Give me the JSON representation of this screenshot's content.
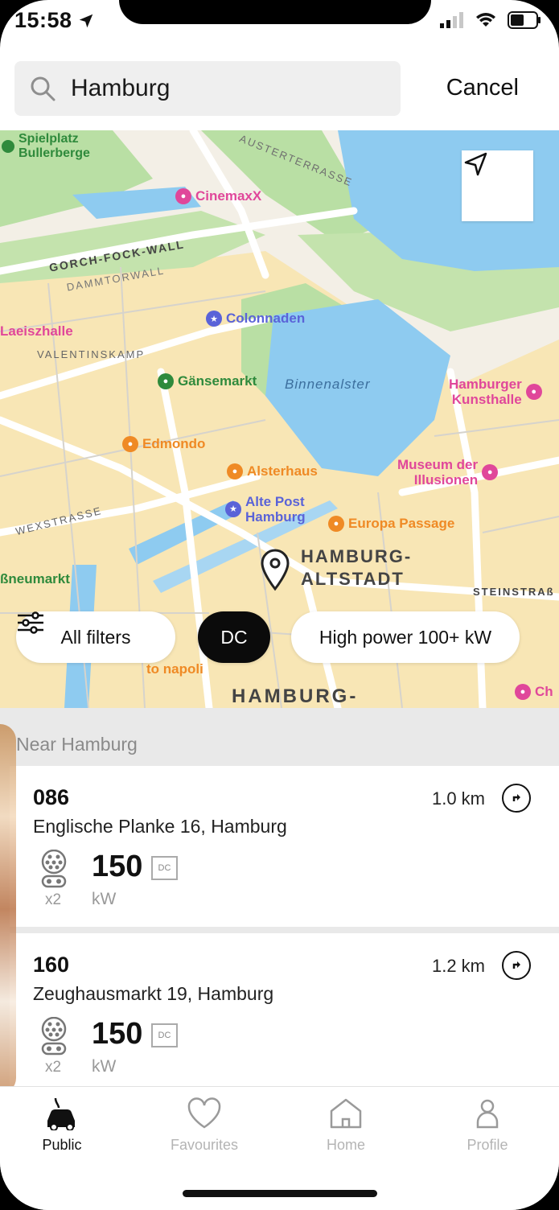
{
  "status": {
    "time": "15:58"
  },
  "search": {
    "query": "Hamburg",
    "cancel_label": "Cancel"
  },
  "map": {
    "labels": {
      "spielplatz": "Spielplatz\nBullerberge",
      "austerterrasse": "AUSTERTERRASSE",
      "cinemaxx": "CinemaxX",
      "gorch": "GORCH-FOCK-WALL",
      "dammtorwall": "DAMMTORWALL",
      "colonnaden": "Colonnaden",
      "laeiszhalle": "Laeiszhalle",
      "valentinskamp": "VALENTINSKAMP",
      "gaensemarkt": "Gänsemarkt",
      "binnenalster": "Binnenalster",
      "kunsthalle": "Hamburger\nKunsthalle",
      "edmondo": "Edmondo",
      "alsterhaus": "Alsterhaus",
      "museum": "Museum der\nIllusionen",
      "altepost": "Alte Post\nHamburg",
      "europa": "Europa Passage",
      "wexstrasse": "WEXSTRASSE",
      "altstadt": "HAMBURG-\nALTSTADT",
      "neumarkt": "ßneumarkt",
      "steinstrasse": "STEINSTRAß",
      "napoli": "to napoli",
      "hamburg_bottom": "HAMBURG-",
      "ch": "Ch"
    }
  },
  "filters": {
    "all_filters": "All filters",
    "dc": "DC",
    "high_power": "High power 100+ kW"
  },
  "list": {
    "section_title": "Near Hamburg",
    "stations": [
      {
        "id": "086",
        "address": "Englische Planke 16, Hamburg",
        "distance": "1.0 km",
        "count": "x2",
        "power": "150",
        "unit": "kW",
        "type": "DC"
      },
      {
        "id": "160",
        "address": "Zeughausmarkt 19, Hamburg",
        "distance": "1.2 km",
        "count": "x2",
        "power": "150",
        "unit": "kW",
        "type": "DC"
      }
    ]
  },
  "tabs": [
    {
      "label": "Public",
      "icon": "car-plug-icon",
      "active": true
    },
    {
      "label": "Favourites",
      "icon": "heart-icon",
      "active": false
    },
    {
      "label": "Home",
      "icon": "home-icon",
      "active": false
    },
    {
      "label": "Profile",
      "icon": "person-icon",
      "active": false
    }
  ],
  "colors": {
    "water": "#8ecbf0",
    "park": "#b9dfa4",
    "urban": "#f8e6b5",
    "accent_dark": "#0b0b0b"
  }
}
